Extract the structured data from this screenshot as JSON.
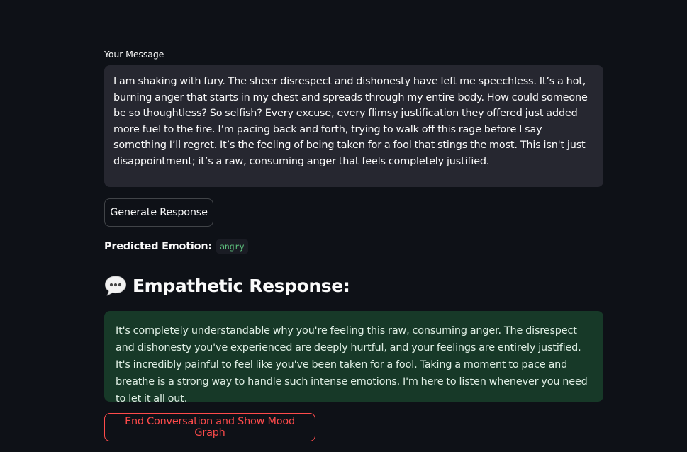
{
  "input": {
    "label": "Your Message",
    "value": "I am shaking with fury. The sheer disrespect and dishonesty have left me speechless. It’s a hot, burning anger that starts in my chest and spreads through my entire body. How could someone be so thoughtless? So selfish? Every excuse, every flimsy justification they offered just added more fuel to the fire. I’m pacing back and forth, trying to walk off this rage before I say something I’ll regret. It’s the feeling of being taken for a fool that stings the most. This isn't just disappointment; it’s a raw, consuming anger that feels completely justified."
  },
  "actions": {
    "generate_label": "Generate Response",
    "end_label": "End Conversation and Show Mood Graph"
  },
  "prediction": {
    "label": "Predicted Emotion:",
    "value": "angry"
  },
  "response": {
    "icon": "speech-bubble-icon",
    "title": "Empathetic Response:",
    "text": "It's completely understandable why you're feeling this raw, consuming anger. The disrespect and dishonesty you've experienced are deeply hurtful, and your feelings are entirely justified. It's incredibly painful to feel like you've been taken for a fool. Taking a moment to pace and breathe is a strong way to handle such intense emotions. I'm here to listen whenever you need to let it all out."
  },
  "colors": {
    "background": "#0e1117",
    "input_bg": "#262730",
    "success_bg": "#173928",
    "accent_red": "#ff4b4b",
    "code_green": "#5ec27e"
  }
}
